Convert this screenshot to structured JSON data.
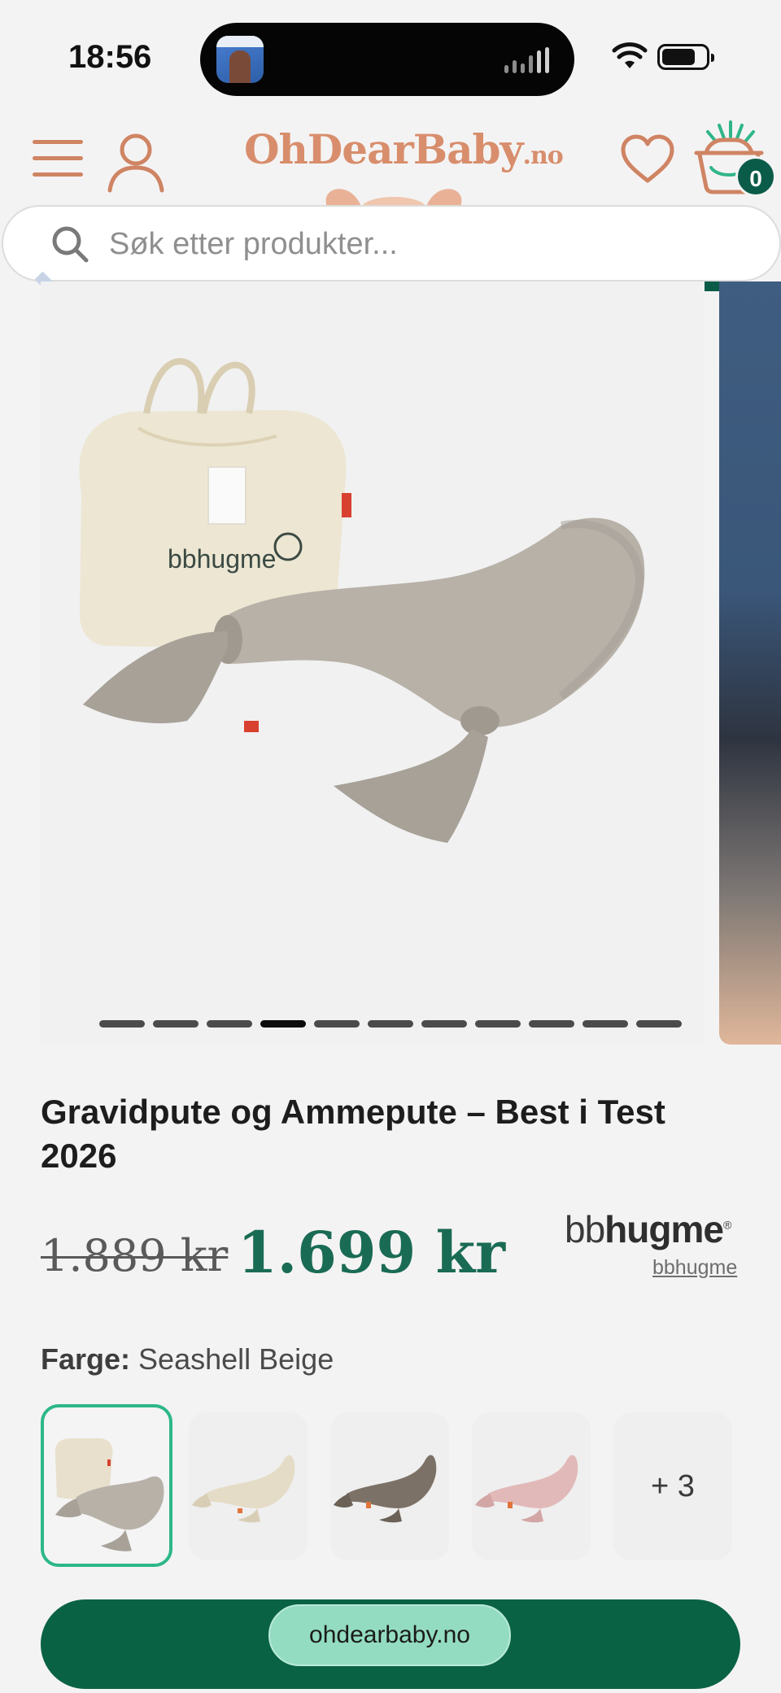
{
  "status_bar": {
    "time": "18:56"
  },
  "header": {
    "logo_main": "OhDearBaby",
    "logo_suffix": ".no",
    "cart_count": "0",
    "accent_color": "#cf8463",
    "badge_color": "#0a5c49"
  },
  "search": {
    "placeholder": "Søk etter produkter..."
  },
  "gallery": {
    "image_count": 11,
    "active_index": 3
  },
  "product": {
    "title": "Gravidpute og Ammepute – Best i Test 2026",
    "old_price": "1.889 kr",
    "price": "1.699 kr",
    "brand_logo_light": "bb",
    "brand_logo_bold": "hugme",
    "brand_logo_mark": "®",
    "brand_link": "bbhugme",
    "color_label": "Farge:",
    "color_value": "Seashell Beige",
    "price_color": "#1a6b54"
  },
  "swatches": {
    "more_label": "+ 3",
    "items": [
      {
        "name": "Seashell Beige",
        "color": "#b9b3aa",
        "selected": true
      },
      {
        "name": "Cream",
        "color": "#e7dfcc",
        "selected": false
      },
      {
        "name": "Taupe",
        "color": "#7c7166",
        "selected": false
      },
      {
        "name": "Rose",
        "color": "#e2b9b9",
        "selected": false
      }
    ]
  },
  "footer": {
    "domain": "ohdearbaby.no",
    "cta_color": "#0a6245"
  }
}
